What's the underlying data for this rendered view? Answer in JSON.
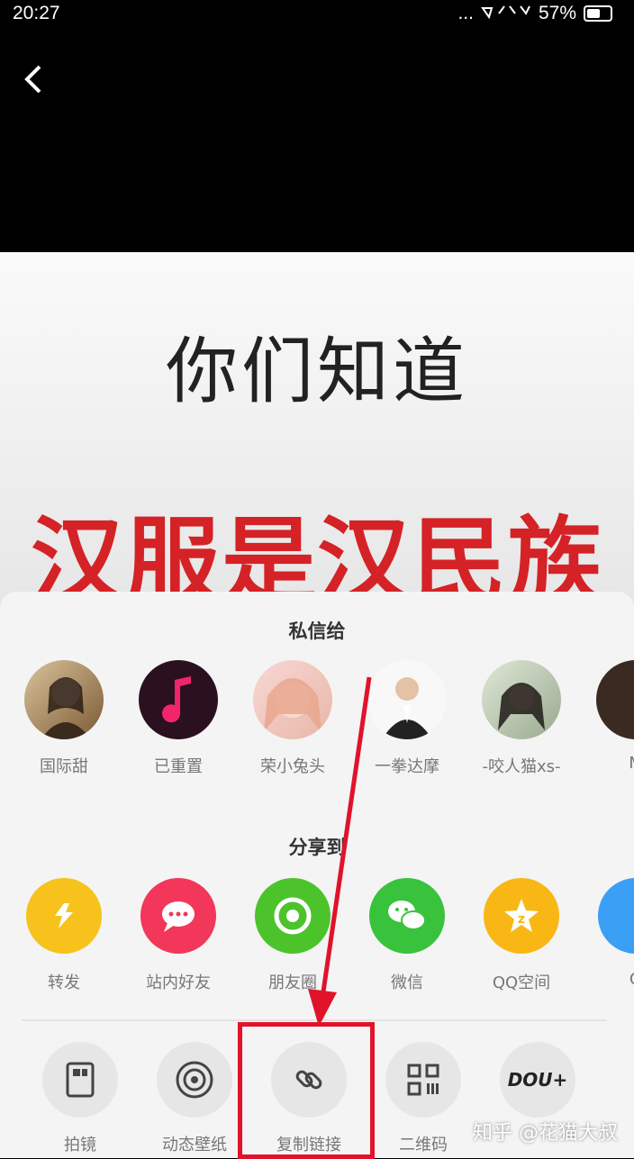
{
  "statusbar": {
    "time": "20:27",
    "signal": "...",
    "battery": "57%"
  },
  "video": {
    "caption_line1": "你们知道",
    "caption_line2": "汉服是汉民族"
  },
  "sheet": {
    "dm_title": "私信给",
    "contacts": [
      {
        "name": "国际甜"
      },
      {
        "name": "已重置"
      },
      {
        "name": "荣小兔头"
      },
      {
        "name": "一拳达摩"
      },
      {
        "name": "-咬人猫xs-"
      },
      {
        "name": "M"
      }
    ],
    "share_title": "分享到",
    "share_targets": [
      {
        "label": "转发",
        "color": "#f7c21b"
      },
      {
        "label": "站内好友",
        "color": "#f2375a"
      },
      {
        "label": "朋友圈",
        "color": "#4cc32b"
      },
      {
        "label": "微信",
        "color": "#39c23c"
      },
      {
        "label": "QQ空间",
        "color": "#f8b714"
      },
      {
        "label": "Q",
        "color": "#3a9ff5"
      }
    ],
    "tools": [
      {
        "label": "拍镜"
      },
      {
        "label": "动态壁纸"
      },
      {
        "label": "复制链接"
      },
      {
        "label": "二维码"
      },
      {
        "label": "DOU+"
      }
    ]
  },
  "watermark": "知乎 @花猫大叔",
  "colors": {
    "accent_red": "#e0132a"
  }
}
